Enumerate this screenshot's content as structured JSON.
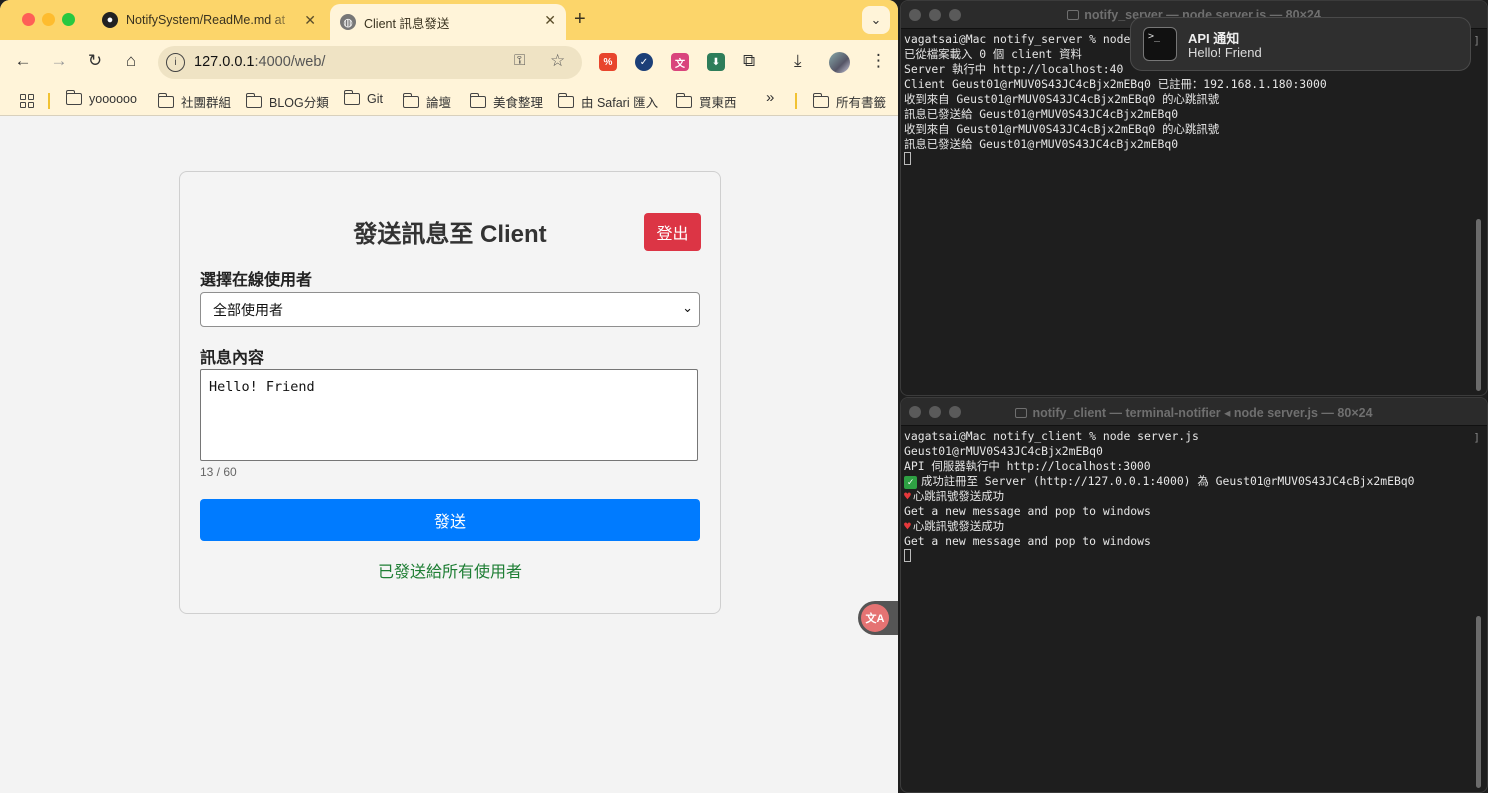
{
  "browser": {
    "tabs": [
      {
        "title": "NotifySystem/ReadMe.md at",
        "icon": "github-icon"
      },
      {
        "title": "Client 訊息發送",
        "icon": "globe-icon"
      }
    ],
    "url_host": "127.0.0.1",
    "url_rest": ":4000/web/",
    "bookmarks": [
      "yoooooo",
      "社團群組",
      "BLOG分類",
      "Git",
      "論壇",
      "美食整理",
      "由 Safari 匯入",
      "買東西"
    ],
    "bookmarks_more": "»",
    "all_bookmarks": "所有書籤"
  },
  "form": {
    "title": "發送訊息至 Client",
    "logout_label": "登出",
    "user_label": "選擇在線使用者",
    "user_selected": "全部使用者",
    "message_label": "訊息內容",
    "message_value": "Hello! Friend",
    "char_count": "13 / 60",
    "send_label": "發送",
    "status_text": "已發送給所有使用者"
  },
  "terminal_server": {
    "title": "notify_server — node server.js — 80×24",
    "lines": [
      "vagatsai@Mac notify_server % node",
      "已從檔案載入 0 個 client 資料",
      "Server 執行中 http://localhost:40",
      "Client Geust01@rMUV0S43JC4cBjx2mEBq0 已註冊：192.168.1.180:3000",
      "收到來自 Geust01@rMUV0S43JC4cBjx2mEBq0 的心跳訊號",
      "訊息已發送給 Geust01@rMUV0S43JC4cBjx2mEBq0",
      "收到來自 Geust01@rMUV0S43JC4cBjx2mEBq0 的心跳訊號",
      "訊息已發送給 Geust01@rMUV0S43JC4cBjx2mEBq0"
    ]
  },
  "terminal_client": {
    "title": "notify_client — terminal-notifier ◂ node server.js — 80×24",
    "lines": [
      "vagatsai@Mac notify_client % node server.js",
      "Geust01@rMUV0S43JC4cBjx2mEBq0",
      "API 伺服器執行中 http://localhost:3000",
      "成功註冊至 Server (http://127.0.0.1:4000) 為 Geust01@rMUV0S43JC4cBjx2mEBq0",
      "心跳訊號發送成功",
      "Get a new message and pop to windows",
      "心跳訊號發送成功",
      "Get a new message and pop to windows"
    ]
  },
  "notification": {
    "title": "API 通知",
    "body": "Hello! Friend",
    "icon": "terminal-icon"
  },
  "colors": {
    "tab_bar": "#fcd56a",
    "logout": "#dc3545",
    "send": "#007bff",
    "status": "#1e7e34"
  }
}
